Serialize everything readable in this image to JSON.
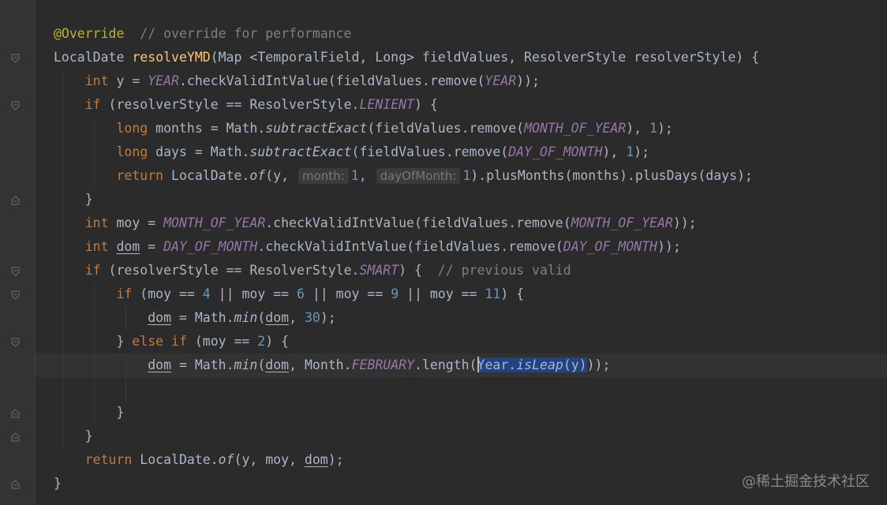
{
  "editor": {
    "lines": [
      {
        "tokens": [
          {
            "t": "@Override",
            "c": "ann"
          },
          {
            "t": "  "
          },
          {
            "t": "// override for performance",
            "c": "cmt"
          }
        ]
      },
      {
        "tokens": [
          {
            "t": "LocalDate "
          },
          {
            "t": "resolveYMD",
            "c": "fn"
          },
          {
            "t": "(Map <TemporalField, Long> fieldValues, ResolverStyle resolverStyle) {"
          }
        ]
      },
      {
        "tokens": [
          {
            "t": "    "
          },
          {
            "t": "int",
            "c": "kw"
          },
          {
            "t": " y = "
          },
          {
            "t": "YEAR",
            "c": "const"
          },
          {
            "t": ".checkValidIntValue(fieldValues.remove("
          },
          {
            "t": "YEAR",
            "c": "const"
          },
          {
            "t": "));"
          }
        ]
      },
      {
        "tokens": [
          {
            "t": "    "
          },
          {
            "t": "if",
            "c": "kw"
          },
          {
            "t": " (resolverStyle == ResolverStyle."
          },
          {
            "t": "LENIENT",
            "c": "const"
          },
          {
            "t": ") {"
          }
        ]
      },
      {
        "tokens": [
          {
            "t": "        "
          },
          {
            "t": "long",
            "c": "kw"
          },
          {
            "t": " months = Math."
          },
          {
            "t": "subtractExact",
            "c": "smeth"
          },
          {
            "t": "(fieldValues.remove("
          },
          {
            "t": "MONTH_OF_YEAR",
            "c": "const"
          },
          {
            "t": "), "
          },
          {
            "t": "1",
            "c": "num"
          },
          {
            "t": ");"
          }
        ]
      },
      {
        "tokens": [
          {
            "t": "        "
          },
          {
            "t": "long",
            "c": "kw"
          },
          {
            "t": " days = Math."
          },
          {
            "t": "subtractExact",
            "c": "smeth"
          },
          {
            "t": "(fieldValues.remove("
          },
          {
            "t": "DAY_OF_MONTH",
            "c": "const"
          },
          {
            "t": "), "
          },
          {
            "t": "1",
            "c": "num"
          },
          {
            "t": ");"
          }
        ]
      },
      {
        "tokens": [
          {
            "t": "        "
          },
          {
            "t": "return",
            "c": "kw"
          },
          {
            "t": " LocalDate."
          },
          {
            "t": "of",
            "c": "smeth"
          },
          {
            "t": "(y, "
          },
          {
            "t": "month:",
            "c": "hint"
          },
          {
            "t": "1",
            "c": "num"
          },
          {
            "t": ", "
          },
          {
            "t": "dayOfMonth:",
            "c": "hint"
          },
          {
            "t": "1",
            "c": "num"
          },
          {
            "t": ").plusMonths(months).plusDays(days);"
          }
        ]
      },
      {
        "tokens": [
          {
            "t": "    }"
          }
        ]
      },
      {
        "tokens": [
          {
            "t": "    "
          },
          {
            "t": "int",
            "c": "kw"
          },
          {
            "t": " moy = "
          },
          {
            "t": "MONTH_OF_YEAR",
            "c": "const"
          },
          {
            "t": ".checkValidIntValue(fieldValues.remove("
          },
          {
            "t": "MONTH_OF_YEAR",
            "c": "const"
          },
          {
            "t": "));"
          }
        ]
      },
      {
        "tokens": [
          {
            "t": "    "
          },
          {
            "t": "int",
            "c": "kw"
          },
          {
            "t": " "
          },
          {
            "t": "dom",
            "c": "uline"
          },
          {
            "t": " = "
          },
          {
            "t": "DAY_OF_MONTH",
            "c": "const"
          },
          {
            "t": ".checkValidIntValue(fieldValues.remove("
          },
          {
            "t": "DAY_OF_MONTH",
            "c": "const"
          },
          {
            "t": "));"
          }
        ]
      },
      {
        "tokens": [
          {
            "t": "    "
          },
          {
            "t": "if",
            "c": "kw"
          },
          {
            "t": " (resolverStyle == ResolverStyle."
          },
          {
            "t": "SMART",
            "c": "const"
          },
          {
            "t": ") {  "
          },
          {
            "t": "// previous valid",
            "c": "cmt"
          }
        ]
      },
      {
        "tokens": [
          {
            "t": "        "
          },
          {
            "t": "if",
            "c": "kw"
          },
          {
            "t": " (moy == "
          },
          {
            "t": "4",
            "c": "num"
          },
          {
            "t": " || moy == "
          },
          {
            "t": "6",
            "c": "num"
          },
          {
            "t": " || moy == "
          },
          {
            "t": "9",
            "c": "num"
          },
          {
            "t": " || moy == "
          },
          {
            "t": "11",
            "c": "num"
          },
          {
            "t": ") {"
          }
        ]
      },
      {
        "tokens": [
          {
            "t": "            "
          },
          {
            "t": "dom",
            "c": "uline"
          },
          {
            "t": " = Math."
          },
          {
            "t": "min",
            "c": "smeth"
          },
          {
            "t": "("
          },
          {
            "t": "dom",
            "c": "uline"
          },
          {
            "t": ", "
          },
          {
            "t": "30",
            "c": "num"
          },
          {
            "t": ");"
          }
        ]
      },
      {
        "tokens": [
          {
            "t": "        } "
          },
          {
            "t": "else if",
            "c": "kw"
          },
          {
            "t": " (moy == "
          },
          {
            "t": "2",
            "c": "num"
          },
          {
            "t": ") {"
          }
        ]
      },
      {
        "current": true,
        "tokens": [
          {
            "t": "            "
          },
          {
            "t": "dom",
            "c": "uline"
          },
          {
            "t": " = Math."
          },
          {
            "t": "min",
            "c": "smeth"
          },
          {
            "t": "("
          },
          {
            "t": "dom",
            "c": "uline"
          },
          {
            "t": ", Month."
          },
          {
            "t": "FEBRUARY",
            "c": "const"
          },
          {
            "t": ".length("
          },
          {
            "caret": true
          },
          {
            "t": "Year.",
            "c": "sel"
          },
          {
            "t": "isLeap",
            "c": "sel smeth"
          },
          {
            "t": "(y)",
            "c": "sel"
          },
          {
            "t": "));"
          }
        ]
      },
      {
        "tokens": [
          {
            "t": ""
          }
        ]
      },
      {
        "tokens": [
          {
            "t": "        }"
          }
        ]
      },
      {
        "tokens": [
          {
            "t": "    }"
          }
        ]
      },
      {
        "tokens": [
          {
            "t": "    "
          },
          {
            "t": "return",
            "c": "kw"
          },
          {
            "t": " LocalDate."
          },
          {
            "t": "of",
            "c": "smeth"
          },
          {
            "t": "(y, moy, "
          },
          {
            "t": "dom",
            "c": "uline"
          },
          {
            "t": ");"
          }
        ]
      },
      {
        "tokens": [
          {
            "t": "}"
          }
        ]
      }
    ]
  },
  "colors": {
    "background": "#2b2b2b",
    "keyword": "#cc7832",
    "annotation": "#bbb529",
    "comment": "#808080",
    "number": "#6897bb",
    "method_decl": "#ffc66d",
    "constant": "#9876aa",
    "text": "#a9b7c6",
    "selection": "#214283"
  },
  "gutter": {
    "fold_icon": "fold-marker-icon"
  },
  "watermark": {
    "text": "@稀土掘金技术社区"
  }
}
